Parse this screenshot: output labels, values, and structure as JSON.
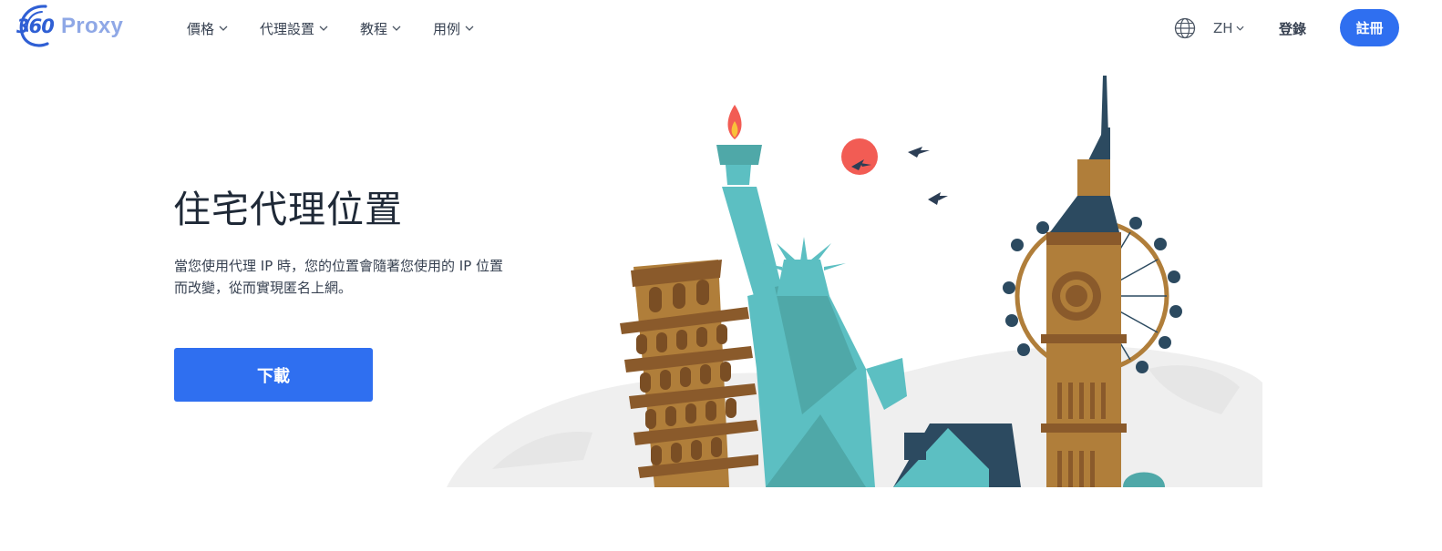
{
  "brand": {
    "logo_mark": "360",
    "logo_text": "Proxy"
  },
  "nav": {
    "items": [
      {
        "label": "價格"
      },
      {
        "label": "代理設置"
      },
      {
        "label": "教程"
      },
      {
        "label": "用例"
      }
    ]
  },
  "header": {
    "language": "ZH",
    "login_label": "登錄",
    "register_label": "註冊"
  },
  "hero": {
    "title": "住宅代理位置",
    "description": "當您使用代理 IP 時，您的位置會隨著您使用的 IP 位置而改變，從而實現匿名上網。",
    "download_label": "下載"
  },
  "icons": {
    "globe": "globe-icon",
    "chevron": "chevron-down-icon"
  },
  "colors": {
    "primary": "#2f6ff0",
    "logo_blue": "#2f5fd4",
    "logo_light": "#8fa8e6"
  }
}
